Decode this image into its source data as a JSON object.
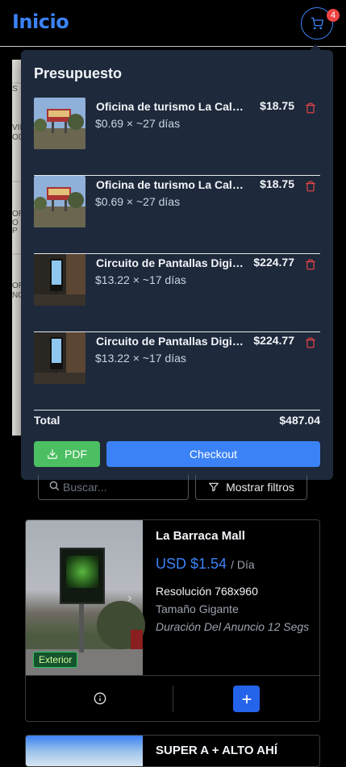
{
  "header": {
    "title": "Inicio",
    "cart_count": "4"
  },
  "map": {
    "labels": [
      "S",
      "VIL",
      "OD",
      "OR",
      "O P",
      "OR",
      "NC"
    ]
  },
  "budget": {
    "title": "Presupuesto",
    "items": [
      {
        "name": "Oficina de turismo La Calera",
        "price": "$18.75",
        "detail": "$0.69 × ~27 días"
      },
      {
        "name": "Oficina de turismo La Calera",
        "price": "$18.75",
        "detail": "$0.69 × ~27 días"
      },
      {
        "name": "Circuito de Pantallas Digitales",
        "price": "$224.77",
        "detail": "$13.22 × ~17 días"
      },
      {
        "name": "Circuito de Pantallas Digitales",
        "price": "$224.77",
        "detail": "$13.22 × ~17 días"
      }
    ],
    "total_label": "Total",
    "total_value": "$487.04",
    "pdf_label": "PDF",
    "checkout_label": "Checkout"
  },
  "search": {
    "placeholder": "Buscar..."
  },
  "filters": {
    "label": "Mostrar filtros"
  },
  "listings": [
    {
      "title": "La Barraca Mall",
      "price": "USD $1.54",
      "price_unit": "/ Día",
      "resolution": "Resolución 768x960",
      "size": "Tamaño Gigante",
      "duration": "Duración Del Anuncio 12 Segs",
      "tag": "Exterior"
    },
    {
      "title": "SUPER A + ALTO AHÍ"
    }
  ],
  "colors": {
    "accent": "#3b82f6",
    "panel": "#1e293b",
    "pdf": "#4bbf61",
    "danger": "#ef4444"
  }
}
